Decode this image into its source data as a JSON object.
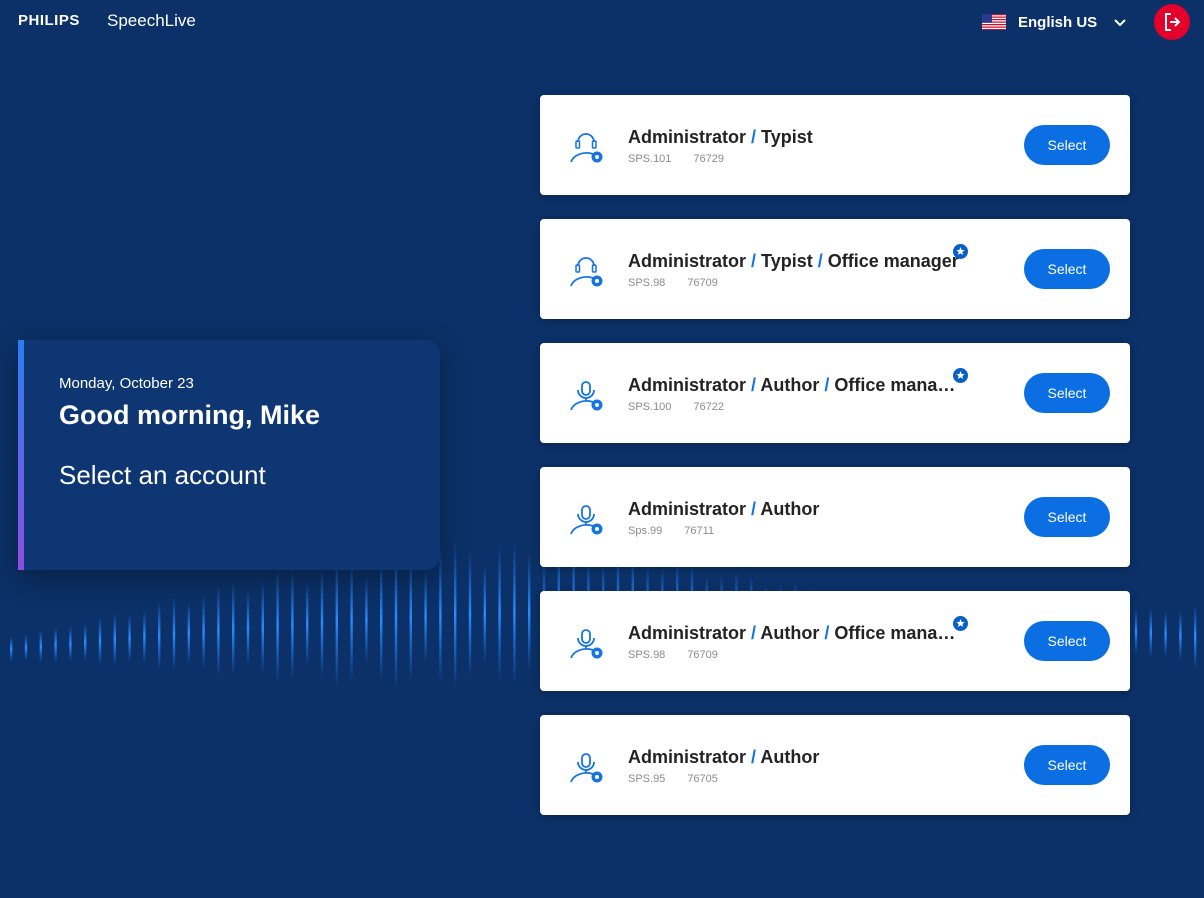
{
  "header": {
    "brand": "PHILIPS",
    "product": "SpeechLive",
    "language": "English US"
  },
  "welcome": {
    "date": "Monday, October 23",
    "greeting": "Good morning, Mike",
    "subtitle": "Select an account"
  },
  "colors": {
    "background": "#0b3168",
    "accent": "#0b6ee3",
    "logout": "#e3002b"
  },
  "accounts": [
    {
      "roles": [
        "Administrator",
        "Typist"
      ],
      "icon": "headset-icon",
      "favorite": false,
      "code": "SPS.101",
      "id": "76729",
      "button": "Select"
    },
    {
      "roles": [
        "Administrator",
        "Typist",
        "Office manager"
      ],
      "icon": "headset-icon",
      "favorite": true,
      "code": "SPS.98",
      "id": "76709",
      "button": "Select"
    },
    {
      "roles": [
        "Administrator",
        "Author",
        "Office manager"
      ],
      "icon": "microphone-icon",
      "favorite": true,
      "code": "SPS.100",
      "id": "76722",
      "button": "Select"
    },
    {
      "roles": [
        "Administrator",
        "Author"
      ],
      "icon": "microphone-icon",
      "favorite": false,
      "code": "Sps.99",
      "id": "76711",
      "button": "Select"
    },
    {
      "roles": [
        "Administrator",
        "Author",
        "Office manager"
      ],
      "icon": "microphone-icon",
      "favorite": true,
      "code": "SPS.98",
      "id": "76709",
      "button": "Select"
    },
    {
      "roles": [
        "Administrator",
        "Author"
      ],
      "icon": "microphone-icon",
      "favorite": false,
      "code": "SPS.95",
      "id": "76705",
      "button": "Select"
    }
  ]
}
